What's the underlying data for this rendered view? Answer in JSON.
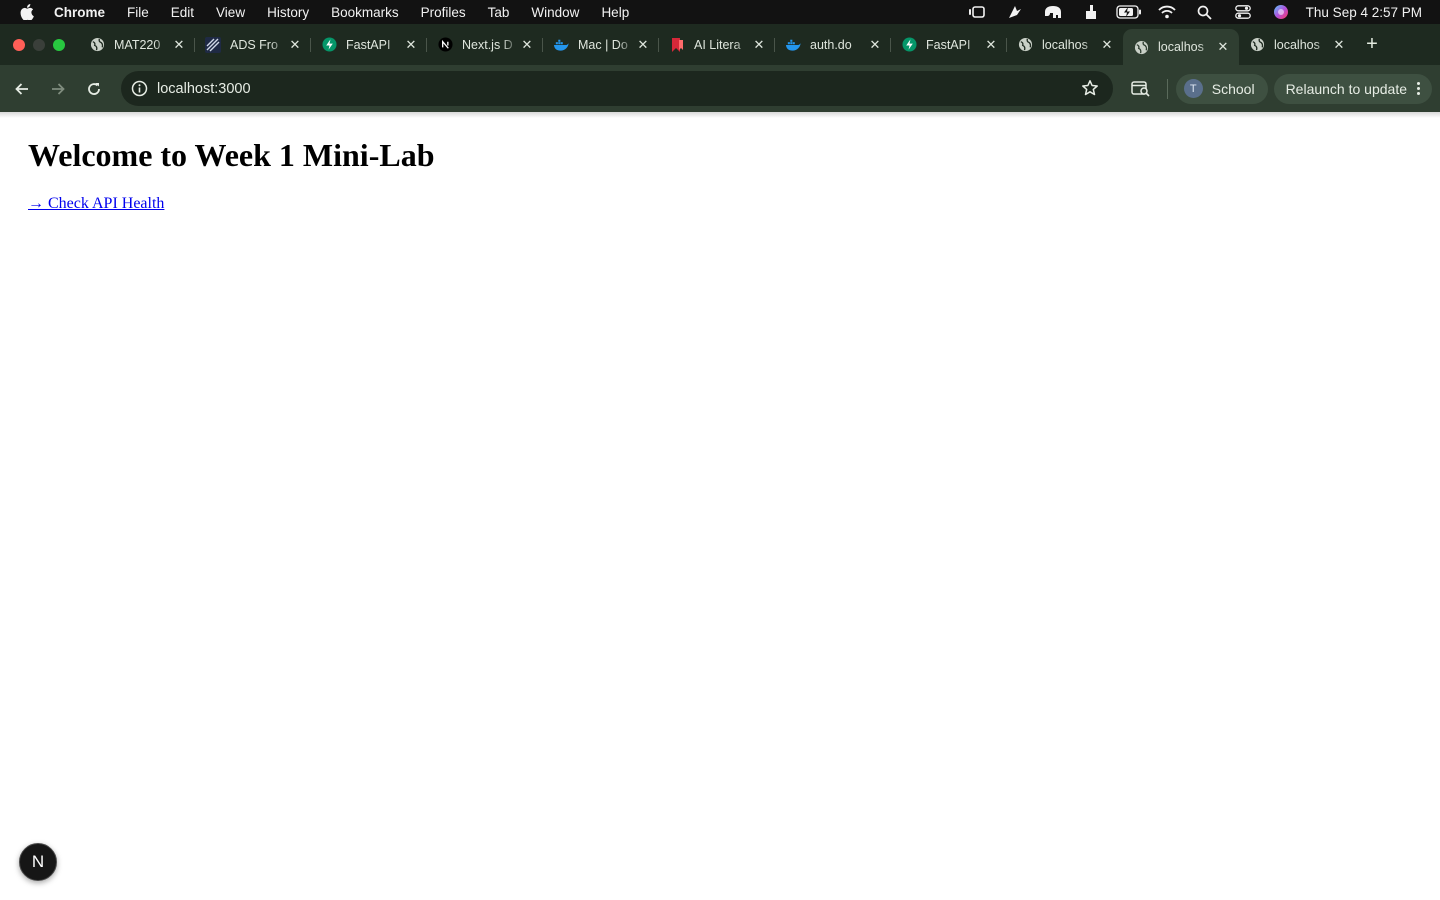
{
  "menubar": {
    "app_name": "Chrome",
    "items": [
      "File",
      "Edit",
      "View",
      "History",
      "Bookmarks",
      "Profiles",
      "Tab",
      "Window",
      "Help"
    ],
    "clock": "Thu Sep 4  2:57 PM"
  },
  "tabs": [
    {
      "title": "MAT220",
      "icon": "globe-icon"
    },
    {
      "title": "ADS Fro",
      "icon": "ads-icon"
    },
    {
      "title": "FastAPI",
      "icon": "fastapi-icon"
    },
    {
      "title": "Next.js D",
      "icon": "nextjs-icon"
    },
    {
      "title": "Mac | Do",
      "icon": "docker-icon"
    },
    {
      "title": "AI Litera",
      "icon": "bookmark-red-icon"
    },
    {
      "title": "auth.do",
      "icon": "docker-icon"
    },
    {
      "title": "FastAPI",
      "icon": "fastapi-icon"
    },
    {
      "title": "localhos",
      "icon": "globe-icon"
    },
    {
      "title": "localhos",
      "icon": "globe-icon",
      "active": true
    },
    {
      "title": "localhos",
      "icon": "globe-icon"
    }
  ],
  "toolbar": {
    "url": "localhost:3000",
    "profile_initial": "T",
    "profile_name": "School",
    "relaunch_label": "Relaunch to update"
  },
  "page": {
    "heading": "Welcome to Week 1 Mini-Lab",
    "link_text": "→ Check API Health"
  },
  "dev_badge": "N",
  "colors": {
    "tabstrip": "#1e2a20",
    "toolbar": "#2f3e31",
    "link": "#0000ee"
  }
}
